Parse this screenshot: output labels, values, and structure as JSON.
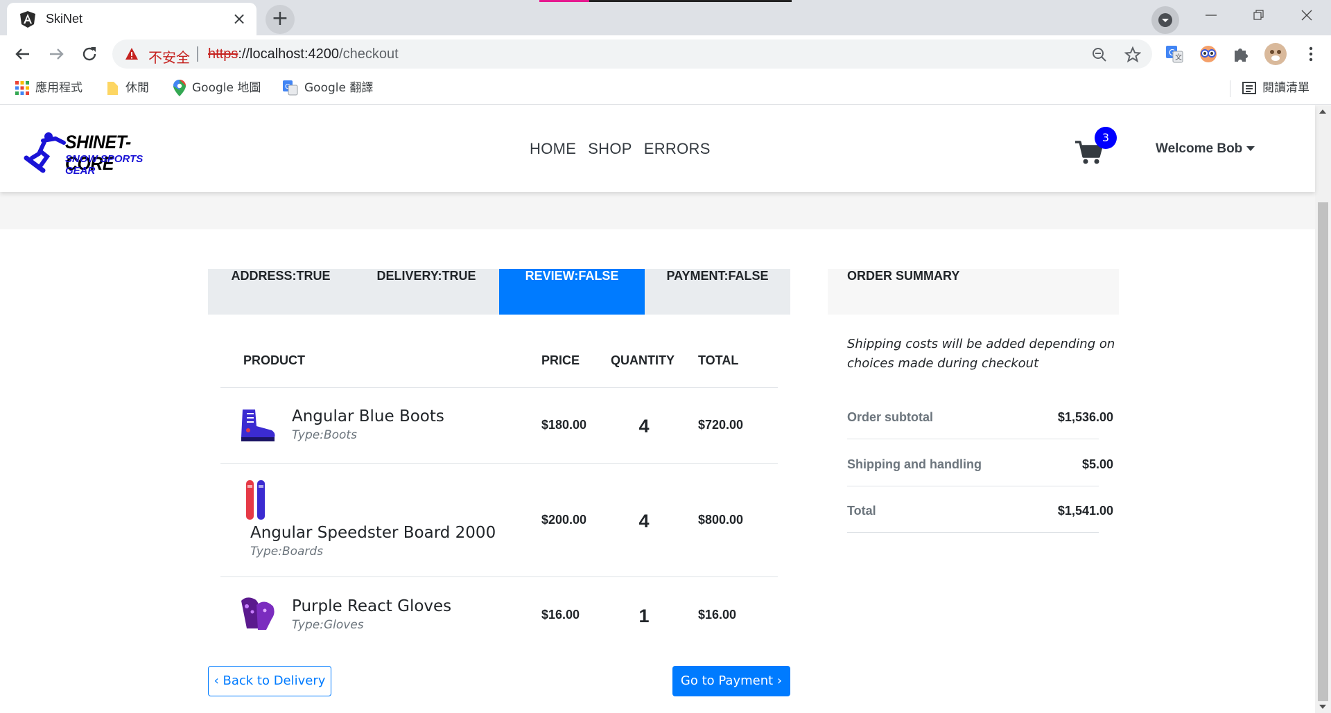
{
  "browser": {
    "tab_title": "SkiNet",
    "tab_close": "×",
    "new_tab": "+",
    "omnibox": {
      "insecure_label": "不安全",
      "url_scheme": "https",
      "url_host": "://localhost:4200",
      "url_path": "/checkout"
    },
    "bookmarks": [
      {
        "label": "應用程式",
        "icon": "apps-grid-icon"
      },
      {
        "label": "休閒",
        "icon": "folder-icon"
      },
      {
        "label": "Google 地圖",
        "icon": "maps-pin-icon"
      },
      {
        "label": "Google 翻譯",
        "icon": "translate-icon"
      }
    ],
    "reading_list": "閱讀清單"
  },
  "header": {
    "logo_line1": "SHINET-CORE",
    "logo_line2": "SNOW SPORTS GEAR",
    "nav": [
      "HOME",
      "SHOP",
      "ERRORS"
    ],
    "cart_count": "3",
    "welcome": "Welcome Bob"
  },
  "steps": [
    {
      "label": "ADDRESS:TRUE",
      "active": false
    },
    {
      "label": "DELIVERY:TRUE",
      "active": false
    },
    {
      "label": "REVIEW:FALSE",
      "active": true
    },
    {
      "label": "PAYMENT:FALSE",
      "active": false
    }
  ],
  "table": {
    "headers": {
      "product": "PRODUCT",
      "price": "PRICE",
      "quantity": "QUANTITY",
      "total": "TOTAL"
    },
    "rows": [
      {
        "name": "Angular Blue Boots",
        "type": "Type:Boots",
        "price": "$180.00",
        "quantity": "4",
        "total": "$720.00"
      },
      {
        "name": "Angular Speedster Board 2000",
        "type": "Type:Boards",
        "price": "$200.00",
        "quantity": "4",
        "total": "$800.00"
      },
      {
        "name": "Purple React Gloves",
        "type": "Type:Gloves",
        "price": "$16.00",
        "quantity": "1",
        "total": "$16.00"
      }
    ]
  },
  "buttons": {
    "back": "‹ Back to Delivery",
    "next": "Go to Payment ›"
  },
  "summary": {
    "title": "ORDER SUMMARY",
    "note": "Shipping costs will be added depending on choices made during checkout",
    "subtotal_label": "Order subtotal",
    "subtotal": "$1,536.00",
    "shipping_label": "Shipping and handling",
    "shipping": "$5.00",
    "total_label": "Total",
    "total": "$1,541.00"
  },
  "colors": {
    "primary": "#007bff",
    "badge": "#0000ff",
    "insecure": "#c5221f"
  }
}
